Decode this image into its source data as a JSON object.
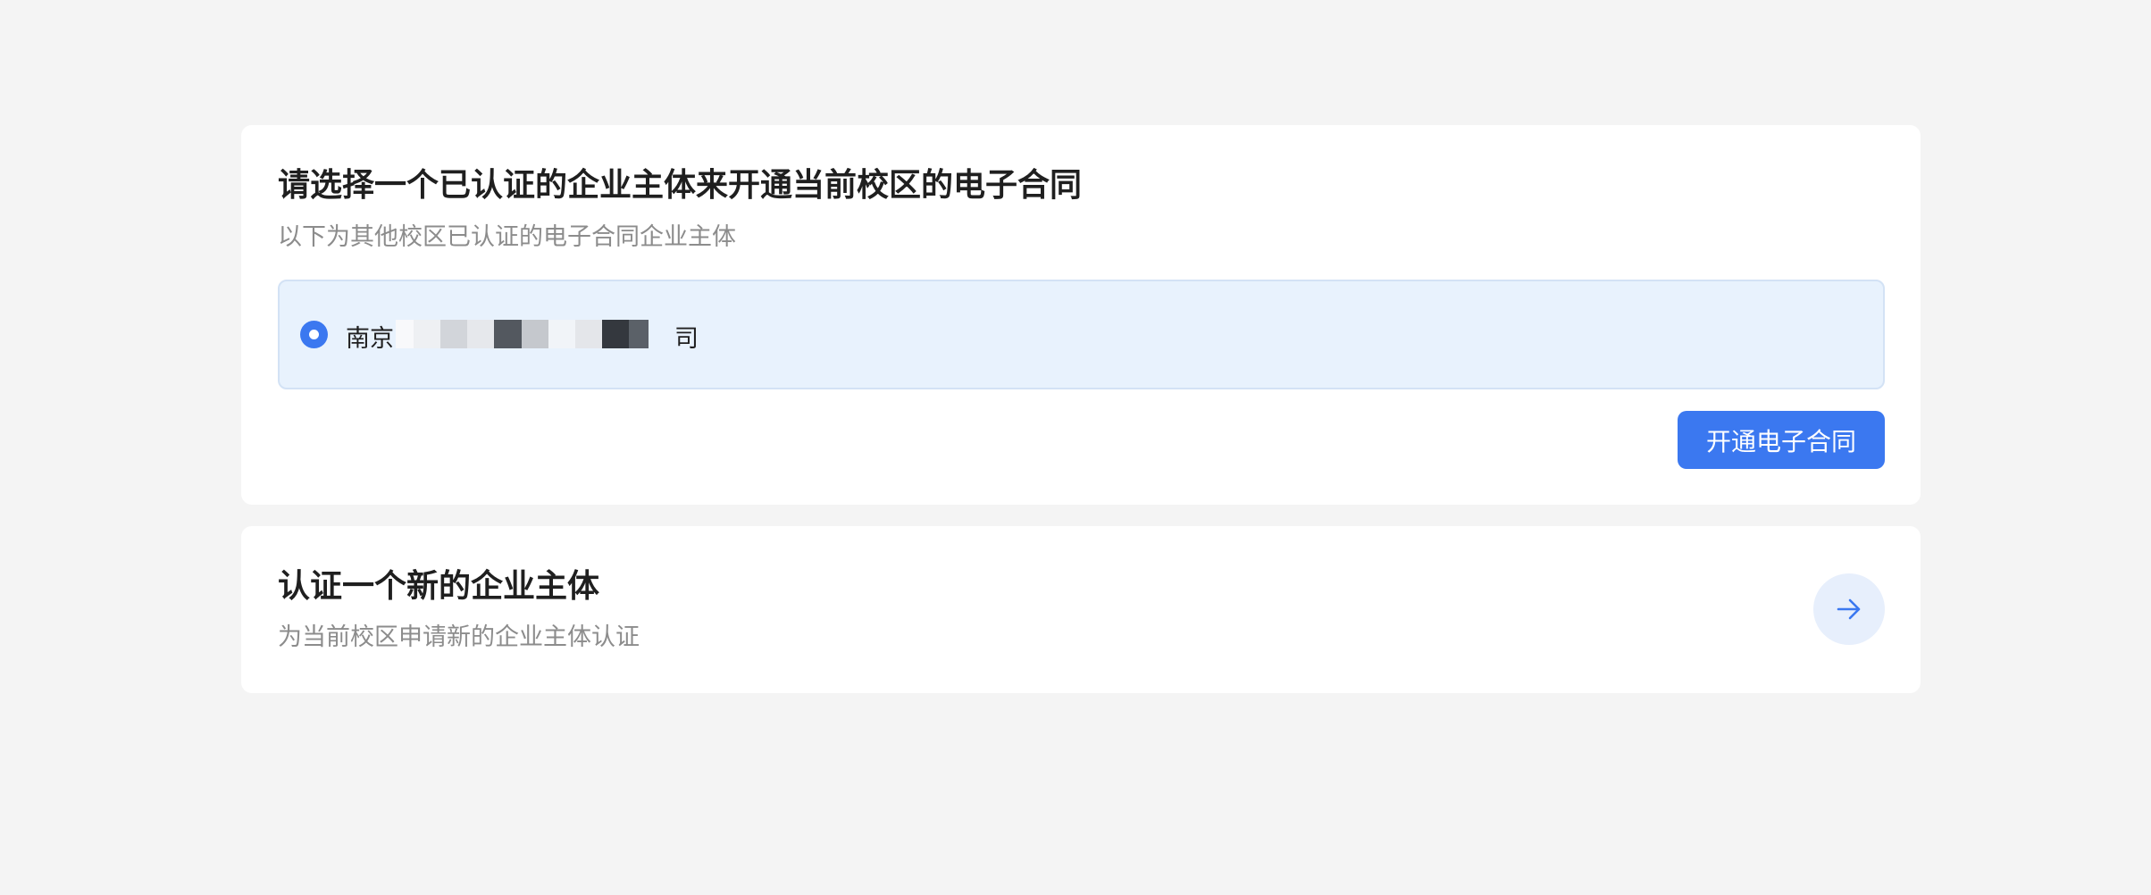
{
  "select_card": {
    "title": "请选择一个已认证的企业主体来开通当前校区的电子合同",
    "subtitle": "以下为其他校区已认证的电子合同企业主体",
    "entities": [
      {
        "name_prefix": "南京",
        "name_suffix": "司",
        "selected": true
      }
    ],
    "open_button_label": "开通电子合同"
  },
  "new_card": {
    "title": "认证一个新的企业主体",
    "subtitle": "为当前校区申请新的企业主体认证",
    "arrow_icon": "arrow-right-icon"
  },
  "colors": {
    "page_background": "#f4f4f4",
    "primary": "#3b78f0",
    "selected_background": "#e8f2fd",
    "subtitle": "#8c8c8c",
    "arrow_circle": "#e7effc"
  }
}
